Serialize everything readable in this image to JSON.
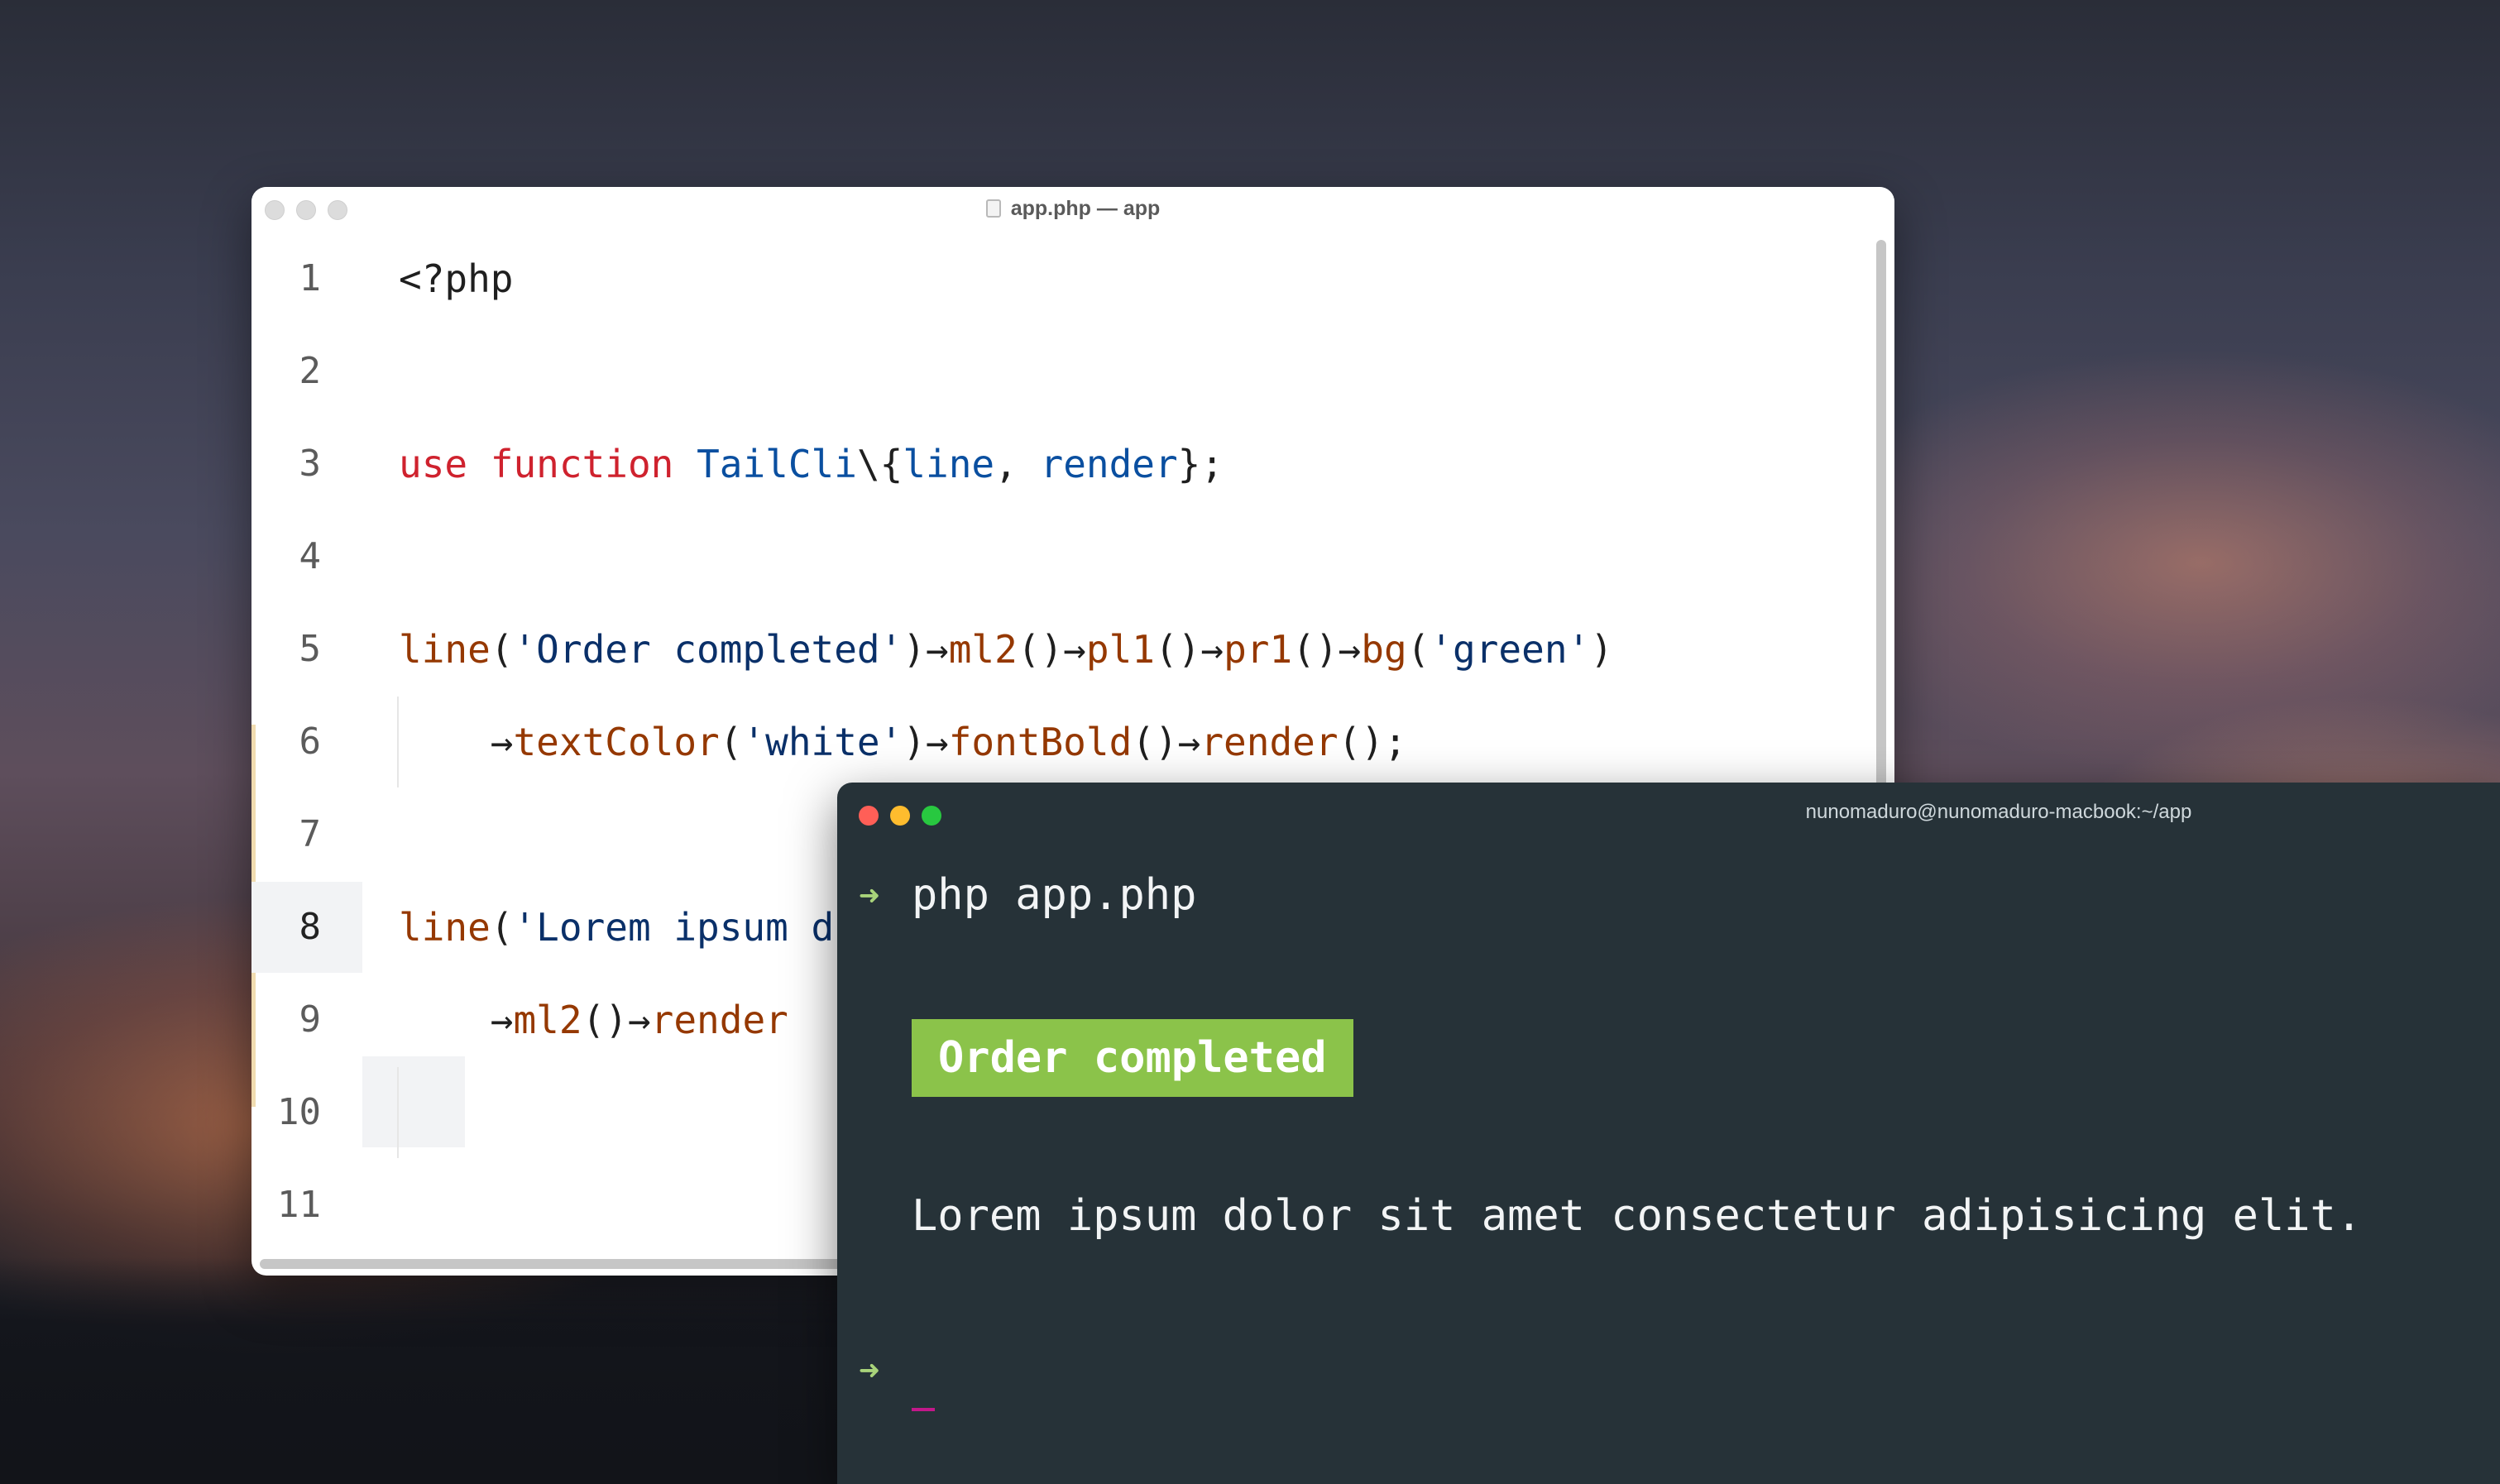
{
  "editor": {
    "title": "app.php — app",
    "line_numbers": [
      "1",
      "2",
      "3",
      "4",
      "5",
      "6",
      "7",
      "8",
      "9",
      "10",
      "11"
    ],
    "active_line": "8",
    "lines": [
      {
        "line": 1,
        "tokens": [
          {
            "t": "<?php",
            "c": "pn"
          }
        ]
      },
      {
        "line": 3,
        "tokens": [
          {
            "t": "use",
            "c": "kw"
          },
          {
            "t": " ",
            "c": "pn"
          },
          {
            "t": "function",
            "c": "kw"
          },
          {
            "t": " ",
            "c": "pn"
          },
          {
            "t": "TailCli",
            "c": "ns"
          },
          {
            "t": "\\{",
            "c": "pn"
          },
          {
            "t": "line",
            "c": "ns"
          },
          {
            "t": ", ",
            "c": "pn"
          },
          {
            "t": "render",
            "c": "ns"
          },
          {
            "t": "};",
            "c": "pn"
          }
        ]
      },
      {
        "line": 5,
        "tokens": [
          {
            "t": "line",
            "c": "fn"
          },
          {
            "t": "(",
            "c": "pn"
          },
          {
            "t": "'Order completed'",
            "c": "str"
          },
          {
            "t": ")→",
            "c": "pn"
          },
          {
            "t": "ml2",
            "c": "fn"
          },
          {
            "t": "()→",
            "c": "pn"
          },
          {
            "t": "pl1",
            "c": "fn"
          },
          {
            "t": "()→",
            "c": "pn"
          },
          {
            "t": "pr1",
            "c": "fn"
          },
          {
            "t": "()→",
            "c": "pn"
          },
          {
            "t": "bg",
            "c": "fn"
          },
          {
            "t": "(",
            "c": "pn"
          },
          {
            "t": "'green'",
            "c": "str"
          },
          {
            "t": ")",
            "c": "pn"
          }
        ]
      },
      {
        "line": 6,
        "tokens": [
          {
            "t": "    →",
            "c": "pn"
          },
          {
            "t": "textColor",
            "c": "fn"
          },
          {
            "t": "(",
            "c": "pn"
          },
          {
            "t": "'white'",
            "c": "str"
          },
          {
            "t": ")→",
            "c": "pn"
          },
          {
            "t": "fontBold",
            "c": "fn"
          },
          {
            "t": "()→",
            "c": "pn"
          },
          {
            "t": "render",
            "c": "fn"
          },
          {
            "t": "();",
            "c": "pn"
          }
        ]
      },
      {
        "line": 8,
        "tokens": [
          {
            "t": "line",
            "c": "fn"
          },
          {
            "t": "(",
            "c": "pn"
          },
          {
            "t": "'Lorem ipsum d",
            "c": "str"
          }
        ]
      },
      {
        "line": 9,
        "tokens": [
          {
            "t": "    →",
            "c": "pn"
          },
          {
            "t": "ml2",
            "c": "fn"
          },
          {
            "t": "()→",
            "c": "pn"
          },
          {
            "t": "render",
            "c": "fn"
          }
        ]
      }
    ]
  },
  "terminal": {
    "title": "nunomaduro@nunomaduro-macbook:~/app",
    "prompt_symbol": "➜",
    "command": "php app.php",
    "badge_text": "Order completed",
    "output_line": "Lorem ipsum dolor sit amet consectetur adipisicing elit.",
    "colors": {
      "background": "#263238",
      "badge": "#8bc34a",
      "prompt": "#a8d37a",
      "cursor": "#c2188a"
    }
  }
}
